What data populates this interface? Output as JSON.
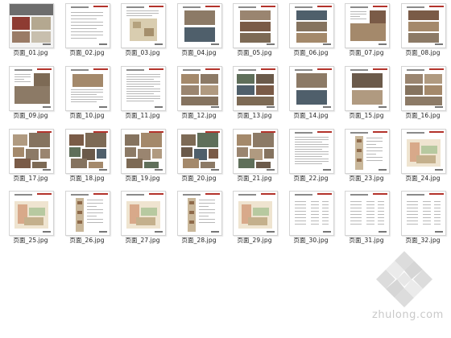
{
  "files": [
    {
      "name": "页面_01.jpg",
      "kind": "cover"
    },
    {
      "name": "页面_02.jpg",
      "kind": "toc"
    },
    {
      "name": "页面_03.jpg",
      "kind": "text-map"
    },
    {
      "name": "页面_04.jpg",
      "kind": "photos-2"
    },
    {
      "name": "页面_05.jpg",
      "kind": "photos-3"
    },
    {
      "name": "页面_06.jpg",
      "kind": "photos-3"
    },
    {
      "name": "页面_07.jpg",
      "kind": "text-photo"
    },
    {
      "name": "页面_08.jpg",
      "kind": "photos-3"
    },
    {
      "name": "页面_09.jpg",
      "kind": "text-photo"
    },
    {
      "name": "页面_10.jpg",
      "kind": "photo-text"
    },
    {
      "name": "页面_11.jpg",
      "kind": "text"
    },
    {
      "name": "页面_12.jpg",
      "kind": "photos-grid"
    },
    {
      "name": "页面_13.jpg",
      "kind": "photos-grid"
    },
    {
      "name": "页面_14.jpg",
      "kind": "photos-2"
    },
    {
      "name": "页面_15.jpg",
      "kind": "photos-2"
    },
    {
      "name": "页面_16.jpg",
      "kind": "photos-grid"
    },
    {
      "name": "页面_17.jpg",
      "kind": "collage"
    },
    {
      "name": "页面_18.jpg",
      "kind": "collage"
    },
    {
      "name": "页面_19.jpg",
      "kind": "collage"
    },
    {
      "name": "页面_20.jpg",
      "kind": "collage"
    },
    {
      "name": "页面_21.jpg",
      "kind": "collage"
    },
    {
      "name": "页面_22.jpg",
      "kind": "text"
    },
    {
      "name": "页面_23.jpg",
      "kind": "section"
    },
    {
      "name": "页面_24.jpg",
      "kind": "sketch"
    },
    {
      "name": "页面_25.jpg",
      "kind": "sketch"
    },
    {
      "name": "页面_26.jpg",
      "kind": "section"
    },
    {
      "name": "页面_27.jpg",
      "kind": "sketch"
    },
    {
      "name": "页面_28.jpg",
      "kind": "section"
    },
    {
      "name": "页面_29.jpg",
      "kind": "sketch"
    },
    {
      "name": "页面_30.jpg",
      "kind": "table"
    },
    {
      "name": "页面_31.jpg",
      "kind": "table"
    },
    {
      "name": "页面_32.jpg",
      "kind": "table"
    }
  ],
  "watermark": {
    "text": "zhulong.com",
    "color": "#c9c9c9"
  },
  "colors": {
    "accent": "#b3332b",
    "border": "#d4d4d4"
  }
}
